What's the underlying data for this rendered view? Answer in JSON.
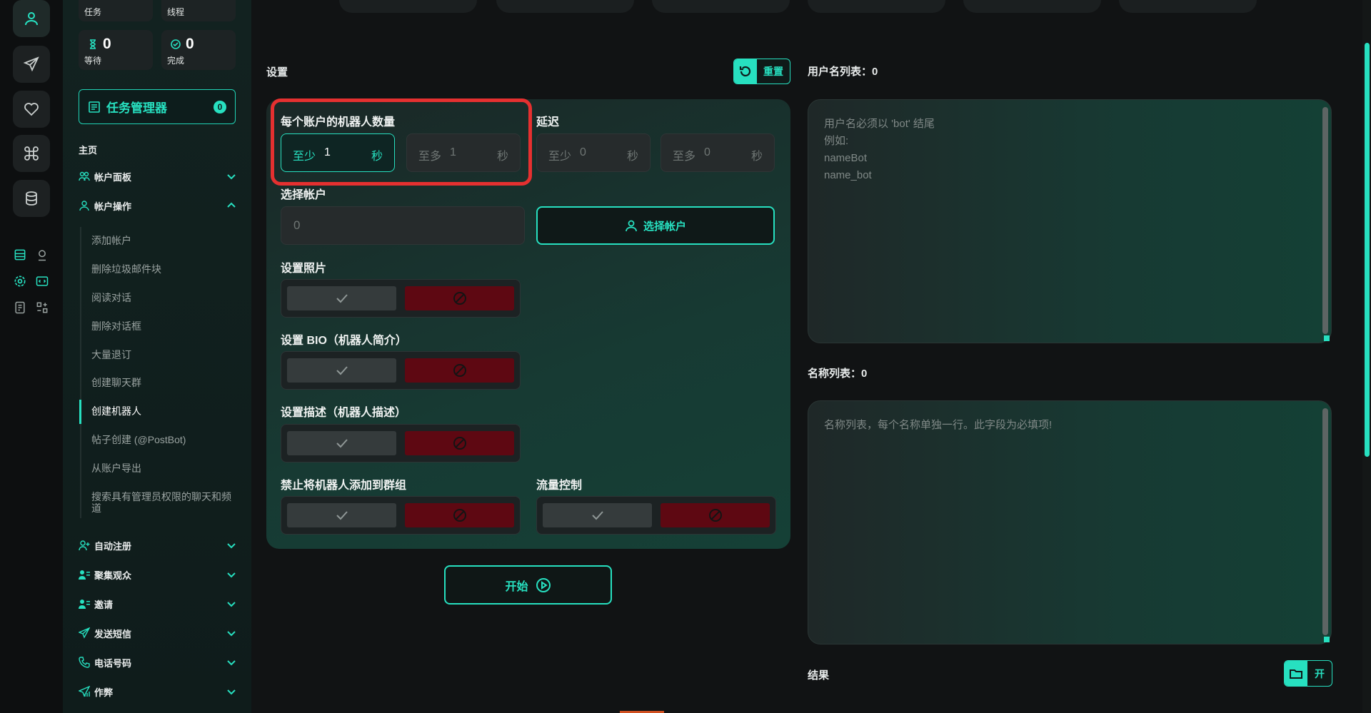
{
  "stats": {
    "tasks_label": "任务",
    "threads_label": "线程",
    "waiting_label": "等待",
    "waiting_value": "0",
    "done_label": "完成",
    "done_value": "0"
  },
  "task_manager": {
    "label": "任务管理器",
    "count": "0"
  },
  "sidebar": {
    "home": "主页",
    "groups": {
      "account_panel": "帐户面板",
      "account_ops": "帐户操作",
      "auto_register": "自动注册",
      "gather_audience": "聚集观众",
      "invite": "邀请",
      "send_sms": "发送短信",
      "phone_number": "电话号码",
      "cheat": "作弊"
    },
    "account_ops_items": [
      "添加帐户",
      "删除垃圾邮件块",
      "阅读对话",
      "删除对话框",
      "大量退订",
      "创建聊天群",
      "创建机器人",
      "帖子创建 (@PostBot)",
      "从账户导出",
      "搜索具有管理员权限的聊天和频道"
    ]
  },
  "settings": {
    "title": "设置",
    "reset_label": "重置",
    "bots_per_account_label": "每个账户的机器人数量",
    "delay_label": "延迟",
    "min_prefix": "至少",
    "max_prefix": "至多",
    "seconds_unit": "秒",
    "bots_min": "1",
    "bots_max": "1",
    "delay_min": "0",
    "delay_max": "0",
    "select_account_label": "选择帐户",
    "select_account_value": "0",
    "select_account_button": "选择帐户",
    "set_photo_label": "设置照片",
    "set_bio_label": "设置 BIO（机器人简介）",
    "set_desc_label": "设置描述（机器人描述）",
    "forbid_groups_label": "禁止将机器人添加到群组",
    "flow_control_label": "流量控制",
    "start_label": "开始"
  },
  "right": {
    "usernames_title": "用户名列表：0",
    "usernames_placeholder": "用户名必须以 'bot' 结尾\n例如:\nnameBot\nname_bot",
    "names_title": "名称列表：0",
    "names_placeholder": "名称列表，每个名称单独一行。此字段为必填项!",
    "result_title": "结果",
    "open_label": "开"
  },
  "colors": {
    "accent": "#27e0c0",
    "danger": "#5e0812",
    "highlight": "#e53030",
    "background": "#111314"
  }
}
